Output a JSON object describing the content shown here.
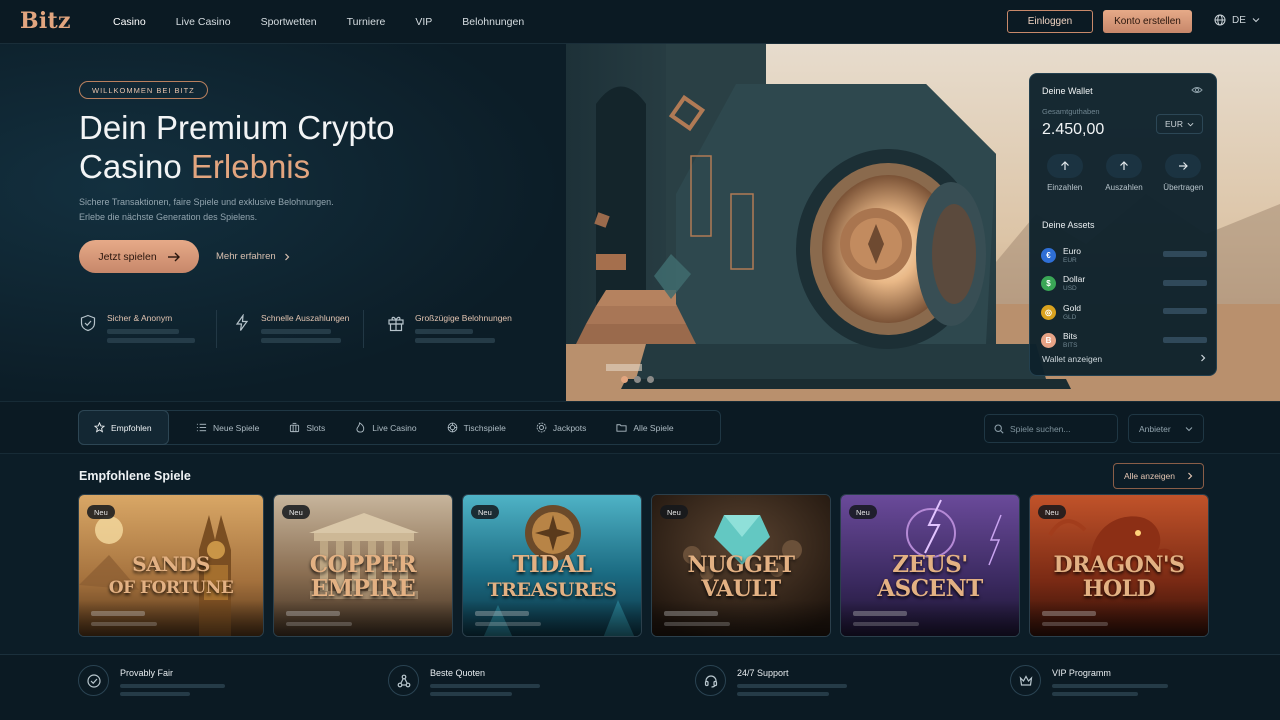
{
  "brand": {
    "logo": "Bitz",
    "accent": "#e2a57f",
    "background": "#0c1d27"
  },
  "nav": {
    "items": [
      "Casino",
      "Live Casino",
      "Sportwetten",
      "Turniere",
      "VIP",
      "Belohnungen"
    ],
    "login_label": "Einloggen",
    "register_label": "Konto erstellen",
    "language": "DE"
  },
  "hero": {
    "pill": "WILLKOMMEN BEI BITZ",
    "title_line1": "Dein Premium Crypto",
    "title_line2_plain": "Casino",
    "title_line2_accent": "Erlebnis",
    "subtitle_line1": "Sichere Transaktionen, faire Spiele und exklusive Belohnungen.",
    "subtitle_line2": "Erlebe die nächste Generation des Spielens.",
    "cta_primary": "Jetzt spielen",
    "cta_secondary": "Mehr erfahren",
    "features": [
      {
        "icon": "shield-check-icon",
        "title": "Sicher & Anonym"
      },
      {
        "icon": "lightning-icon",
        "title": "Schnelle Auszahlungen"
      },
      {
        "icon": "gift-icon",
        "title": "Großzügige Belohnungen"
      }
    ],
    "carousel": {
      "slides": 3,
      "active": 1
    }
  },
  "wallet": {
    "title": "Deine Wallet",
    "balance_label": "Gesamtguthaben",
    "balance": "2.450,00",
    "currency": "EUR",
    "actions": [
      {
        "icon": "arrow-up-icon",
        "label": "Einzahlen"
      },
      {
        "icon": "arrow-up-icon",
        "label": "Auszahlen"
      },
      {
        "icon": "arrow-right-icon",
        "label": "Übertragen"
      }
    ],
    "assets_title": "Deine Assets",
    "assets": [
      {
        "name": "Euro",
        "code": "EUR",
        "symbol": "€",
        "color": "#2f6fd6"
      },
      {
        "name": "Dollar",
        "code": "USD",
        "symbol": "$",
        "color": "#3aa656"
      },
      {
        "name": "Gold",
        "code": "GLD",
        "symbol": "◎",
        "color": "#d9a21f"
      },
      {
        "name": "Bits",
        "code": "BITS",
        "symbol": "B",
        "color": "#e7a386"
      }
    ],
    "view_label": "Wallet anzeigen"
  },
  "categories": {
    "items": [
      {
        "label": "Empfohlen",
        "icon": "star-icon",
        "active": true
      },
      {
        "label": "Neue Spiele",
        "icon": "list-icon",
        "active": false
      },
      {
        "label": "Slots",
        "icon": "slot-machine-icon",
        "active": false
      },
      {
        "label": "Live Casino",
        "icon": "live-icon",
        "active": false
      },
      {
        "label": "Tischspiele",
        "icon": "table-chip-icon",
        "active": false
      },
      {
        "label": "Jackpots",
        "icon": "jackpot-icon",
        "active": false
      },
      {
        "label": "Alle Spiele",
        "icon": "folder-icon",
        "active": false
      }
    ],
    "search_placeholder": "Spiele suchen...",
    "provider_label": "Anbieter"
  },
  "featured": {
    "title": "Empfohlene Spiele",
    "view_all": "Alle anzeigen",
    "games": [
      {
        "badge": "Neu",
        "name_line1": "SANDS",
        "name_line2": "OF FORTUNE"
      },
      {
        "badge": "Neu",
        "name_line1": "COPPER",
        "name_line2": "EMPIRE"
      },
      {
        "badge": "Neu",
        "name_line1": "TIDAL",
        "name_line2": "TREASURES"
      },
      {
        "badge": "Neu",
        "name_line1": "NUGGET",
        "name_line2": "VAULT"
      },
      {
        "badge": "Neu",
        "name_line1": "ZEUS'",
        "name_line2": "ASCENT"
      },
      {
        "badge": "Neu",
        "name_line1": "DRAGON'S",
        "name_line2": "HOLD"
      }
    ]
  },
  "footer": {
    "items": [
      {
        "icon": "check-circle-icon",
        "title": "Provably Fair"
      },
      {
        "icon": "network-icon",
        "title": "Beste Quoten"
      },
      {
        "icon": "headset-icon",
        "title": "24/7 Support"
      },
      {
        "icon": "crown-icon",
        "title": "VIP Programm"
      }
    ]
  }
}
